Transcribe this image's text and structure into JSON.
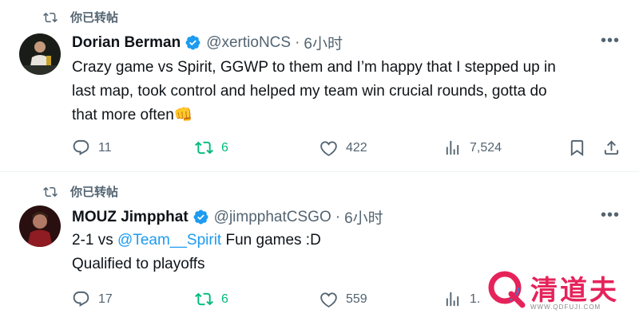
{
  "tweets": [
    {
      "retweet_label": "你已转帖",
      "author": {
        "name": "Dorian Berman",
        "handle": "@xertioNCS",
        "time": "6小时"
      },
      "text_lines": [
        "Crazy game vs Spirit, GGWP to them and I’m happy that I stepped up in",
        "last map, took control and helped my team win crucial rounds, gotta do",
        "that more often👊"
      ],
      "stats": {
        "replies": "11",
        "reposts": "6",
        "likes": "422",
        "views": "7,524"
      }
    },
    {
      "retweet_label": "你已转帖",
      "author": {
        "name": "MOUZ Jimpphat",
        "handle": "@jimpphatCSGO",
        "time": "6小时"
      },
      "text": {
        "prefix": "2-1 vs ",
        "mention": "@Team__Spirit",
        "suffix": " Fun games :D",
        "line2": "Qualified to playoffs"
      },
      "stats": {
        "replies": "17",
        "reposts": "6",
        "likes": "559",
        "views": "1."
      }
    }
  ],
  "watermark": {
    "brand": "清道夫",
    "url": "WWW.QDFUJI.COM"
  },
  "colors": {
    "accent": "#1d9bf0",
    "repost": "#00ba7c",
    "muted": "#536471",
    "watermark": "#e5235a"
  },
  "icons": [
    "repost-icon",
    "verified-icon",
    "more-icon",
    "reply-icon",
    "heart-icon",
    "views-icon",
    "bookmark-icon",
    "share-icon"
  ]
}
